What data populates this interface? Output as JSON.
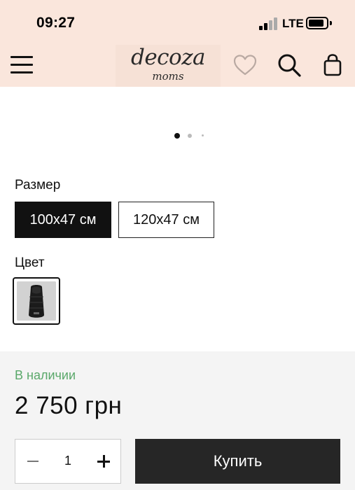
{
  "status_bar": {
    "time": "09:27",
    "network": "LTE",
    "icons": [
      "signal-icon",
      "battery-icon"
    ]
  },
  "header": {
    "logo_text": "decoza",
    "logo_subtext": "moms",
    "icons": [
      "menu-icon",
      "heart-icon",
      "search-icon",
      "bag-icon"
    ],
    "background_color": "#fae6dc"
  },
  "gallery": {
    "slide_count": 3,
    "active_slide": 1
  },
  "size": {
    "label": "Размер",
    "options": [
      "100x47 см",
      "120x47 см"
    ],
    "selected": "100x47 см"
  },
  "color": {
    "label": "Цвет",
    "swatch_icon": "sleeping-bag-thumbnail"
  },
  "purchase": {
    "availability": "В наличии",
    "availability_color": "#5aa86a",
    "price": "2 750 грн",
    "quantity": "1",
    "buy_label": "Купить"
  }
}
